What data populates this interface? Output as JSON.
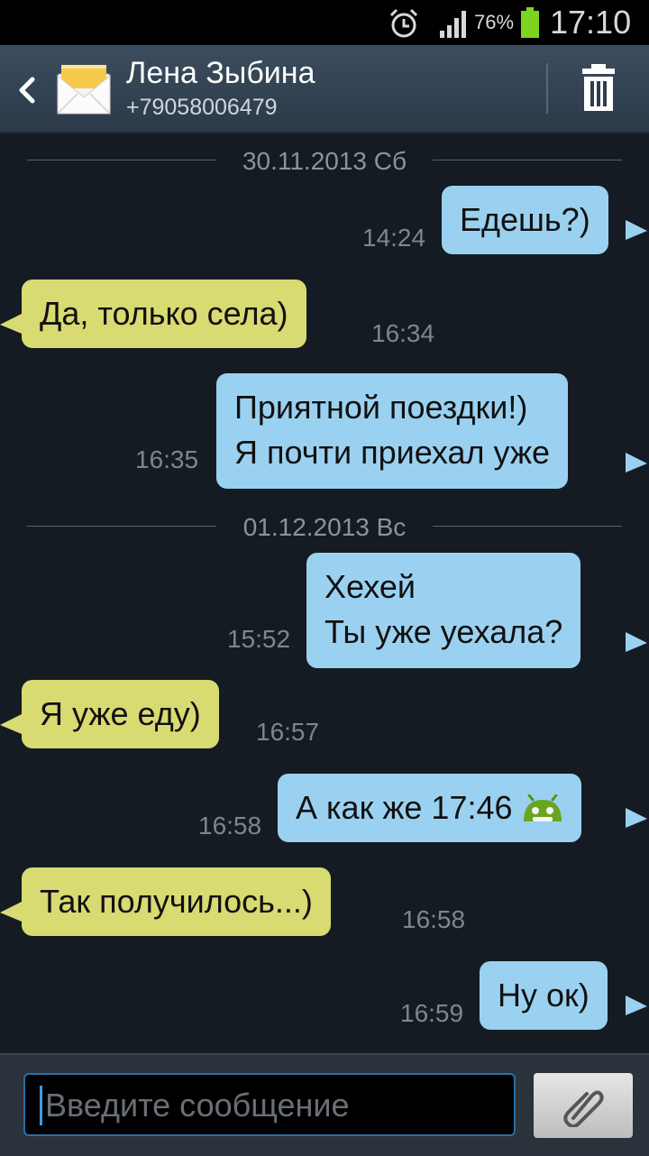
{
  "status_bar": {
    "battery": "76%",
    "time": "17:10"
  },
  "header": {
    "contact_name": "Лена Зыбина",
    "phone": "+79058006479"
  },
  "thread": {
    "date_1": "30.11.2013 Сб",
    "date_2": "01.12.2013 Вс",
    "messages": [
      {
        "dir": "out",
        "lines": [
          "Едешь?)"
        ],
        "time": "14:24"
      },
      {
        "dir": "in",
        "lines": [
          "Да, только села)"
        ],
        "time": "16:34"
      },
      {
        "dir": "out",
        "lines": [
          "Приятной поездки!)",
          "Я почти приехал уже"
        ],
        "time": "16:35"
      },
      {
        "dir": "out",
        "lines": [
          "Хехей",
          "Ты уже уехала?"
        ],
        "time": "15:52"
      },
      {
        "dir": "in",
        "lines": [
          "Я уже еду)"
        ],
        "time": "16:57"
      },
      {
        "dir": "out",
        "lines": [
          "А как же 17:46"
        ],
        "time": "16:58",
        "emoji": "android-emoji-icon"
      },
      {
        "dir": "in",
        "lines": [
          "Так получилось...)"
        ],
        "time": "16:58"
      },
      {
        "dir": "out",
        "lines": [
          "Ну ок)"
        ],
        "time": "16:59"
      }
    ]
  },
  "composer": {
    "placeholder": "Введите сообщение"
  },
  "colors": {
    "background": "#151b22",
    "outgoing_bubble": "#9bd1f0",
    "incoming_bubble": "#d8da72",
    "accent": "#3c9ce6"
  },
  "icons": [
    "back-icon",
    "envelope-icon",
    "trash-icon",
    "paperclip-icon",
    "alarm-icon",
    "signal-icon",
    "battery-icon",
    "android-emoji-icon"
  ]
}
